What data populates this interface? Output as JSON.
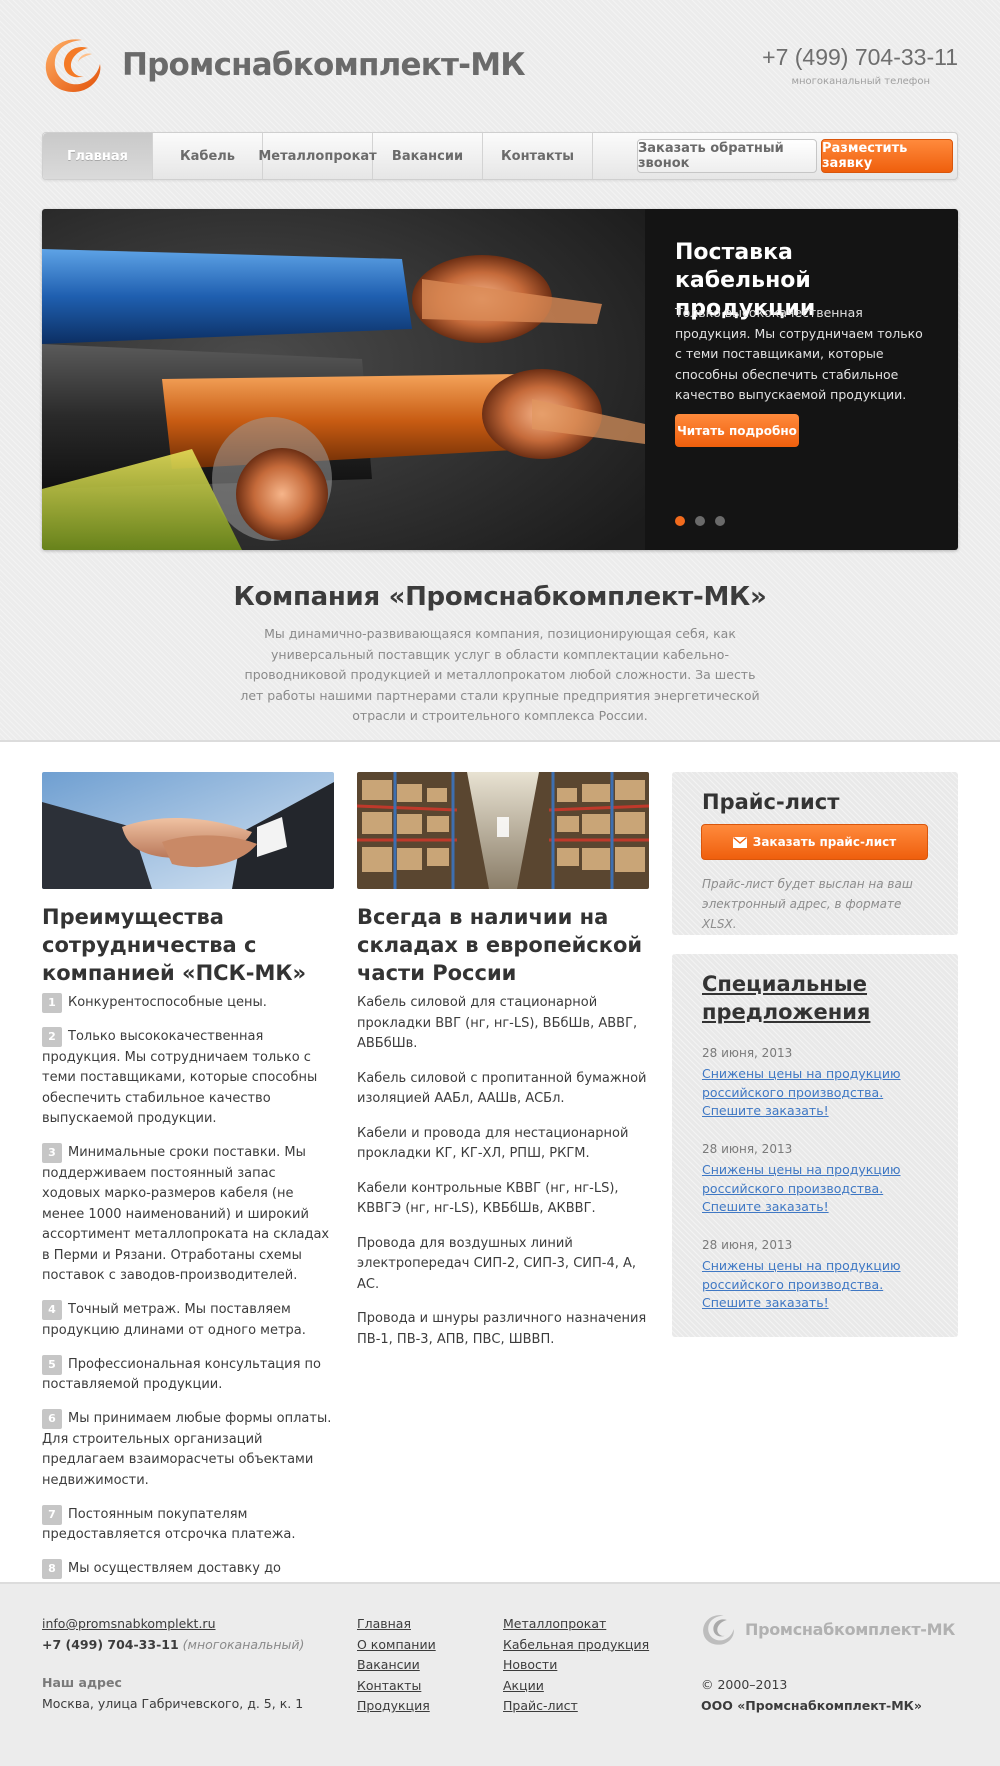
{
  "header": {
    "logo_text": "Промснабкомплект-МК",
    "phone": "+7 (499) 704-33-11",
    "phone_note": "многоканальный телефон"
  },
  "nav": {
    "items": [
      {
        "label": "Главная",
        "active": true
      },
      {
        "label": "Кабель",
        "active": false
      },
      {
        "label": "Металлопрокат",
        "active": false
      },
      {
        "label": "Вакансии",
        "active": false
      },
      {
        "label": "Контакты",
        "active": false
      }
    ],
    "callback_button": "Заказать обратный звонок",
    "order_button": "Разместить заявку"
  },
  "slider": {
    "title": "Поставка кабельной продукции",
    "text": "Только высококачественная продукция. Мы сотрудничаем только с теми поставщиками, которые способны обеспечить стабильное качество выпускаемой продукции.",
    "button": "Читать подробно",
    "slides_count": 3,
    "active_slide": 1
  },
  "intro": {
    "title": "Компания «Промснабкомплект-МК»",
    "text": "Мы динамично-развивающаяся компания, позиционирующая себя, как универсальный поставщик услуг в области комплектации кабельно-проводниковой продукцией и металлопрокатом любой сложности. За шесть лет работы нашими партнерами стали крупные предприятия энергетической отрасли и строительного комплекса России."
  },
  "advantages": {
    "title": "Преимущества сотрудничества с компанией «ПСК-МК»",
    "items": [
      {
        "num": "1",
        "text": "Конкурентоспособные цены."
      },
      {
        "num": "2",
        "text": "Только высококачественная продукция. Мы сотрудничаем только с теми поставщиками, которые способны обеспечить стабильное качество выпускаемой продукции."
      },
      {
        "num": "3",
        "text": "Минимальные сроки поставки. Мы поддерживаем постоянный запас ходовых марко-размеров кабеля (не менее 1000 наименований) и широкий ассортимент металлопроката на складах в Перми и Рязани. Отработаны схемы поставок с заводов-производителей."
      },
      {
        "num": "4",
        "text": "Точный метраж. Мы поставляем продукцию длинами от одного метра."
      },
      {
        "num": "5",
        "text": "Профессиональная консультация по поставляемой продукции."
      },
      {
        "num": "6",
        "text": "Мы принимаем любые формы оплаты. Для строительных организаций предлагаем взаиморасчеты объектами недвижимости."
      },
      {
        "num": "7",
        "text": "Постоянным покупателям предоставляется отсрочка платежа."
      },
      {
        "num": "8",
        "text": "Мы осуществляем доставку до объекта."
      }
    ]
  },
  "stock": {
    "title": "Всегда в наличии на складах в европейской части России",
    "items": [
      "Кабель силовой для стационарной прокладки ВВГ (нг, нг-LS), ВБбШв, АВВГ, АВБбШв.",
      "Кабель силовой с пропитанной бумажной изоляцией ААБл, ААШв, АСБл.",
      "Кабели и провода для нестационарной прокладки КГ, КГ-ХЛ, РПШ, РКГМ.",
      "Кабели контрольные КВВГ (нг, нг-LS), КВВГЭ (нг, нг-LS), КВБбШв, АКВВГ.",
      "Провода для воздушных линий электропередач СИП-2, СИП-3, СИП-4, А, АС.",
      "Провода и шнуры различного назначения ПВ-1, ПВ-3, АПВ, ПВС, ШВВП."
    ]
  },
  "price_list": {
    "title": "Прайс-лист",
    "button": "Заказать прайс-лист",
    "note": "Прайс-лист будет выслан на ваш электронный адрес, в формате XLSX."
  },
  "specials": {
    "title": "Специальные предложения",
    "offers": [
      {
        "date": "28 июня, 2013",
        "text": "Снижены цены на продукцию российского производства. Спешите заказать!"
      },
      {
        "date": "28 июня, 2013",
        "text": "Снижены цены на продукцию российского производства. Спешите заказать!"
      },
      {
        "date": "28 июня, 2013",
        "text": "Снижены цены на продукцию российского производства. Спешите заказать!"
      }
    ]
  },
  "footer": {
    "email": "info@promsnabkomplekt.ru",
    "phone": "+7 (499) 704-33-11",
    "phone_note": "(многоканальный)",
    "address_label": "Наш адрес",
    "address": "Москва, улица Габричевского, д. 5, к. 1",
    "links_col1": [
      "Главная",
      "О компании",
      "Вакансии",
      "Контакты",
      "Продукция"
    ],
    "links_col2": [
      "Металлопрокат",
      "Кабельная продукция",
      "Новости",
      "Акции",
      "Прайс-лист"
    ],
    "logo_text": "Промснабкомплект-МК",
    "copyright": "© 2000–2013",
    "company": "ООО «Промснабкомплект-МК»"
  },
  "colors": {
    "accent": "#f26b1d",
    "link": "#3f78c4",
    "background": "#ececec"
  }
}
